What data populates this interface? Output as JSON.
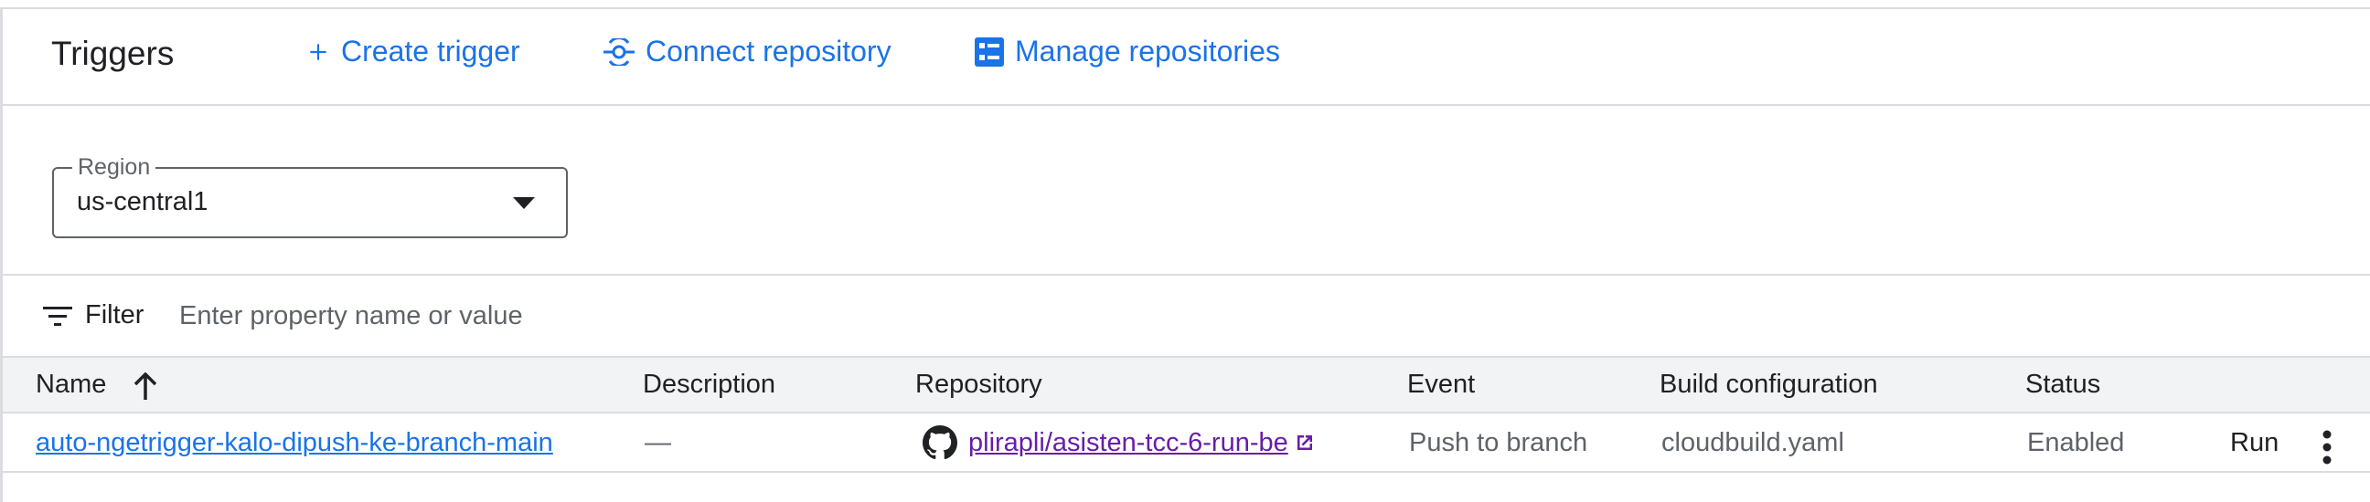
{
  "header": {
    "title": "Triggers",
    "create_trigger": "Create trigger",
    "connect_repository": "Connect repository",
    "manage_repositories": "Manage repositories"
  },
  "region": {
    "label": "Region",
    "value": "us-central1"
  },
  "filter": {
    "label": "Filter",
    "placeholder": "Enter property name or value"
  },
  "table": {
    "columns": {
      "name": "Name",
      "description": "Description",
      "repository": "Repository",
      "event": "Event",
      "build_configuration": "Build configuration",
      "status": "Status"
    },
    "rows": [
      {
        "name": "auto-ngetrigger-kalo-dipush-ke-branch-main",
        "description": "—",
        "repository": "plirapli/asisten-tcc-6-run-be",
        "event": "Push to branch",
        "build_configuration": "cloudbuild.yaml",
        "status": "Enabled",
        "run": "Run"
      }
    ]
  },
  "colors": {
    "accent": "#1a73e8",
    "visited_link": "#681da8",
    "header_bg": "#f1f3f4",
    "border": "#dadce0"
  },
  "icons": [
    "add-icon",
    "connect-icon",
    "repositories-icon",
    "dropdown-caret-icon",
    "filter-icon",
    "sort-ascending-icon",
    "github-icon",
    "external-link-icon",
    "more-vert-icon"
  ]
}
